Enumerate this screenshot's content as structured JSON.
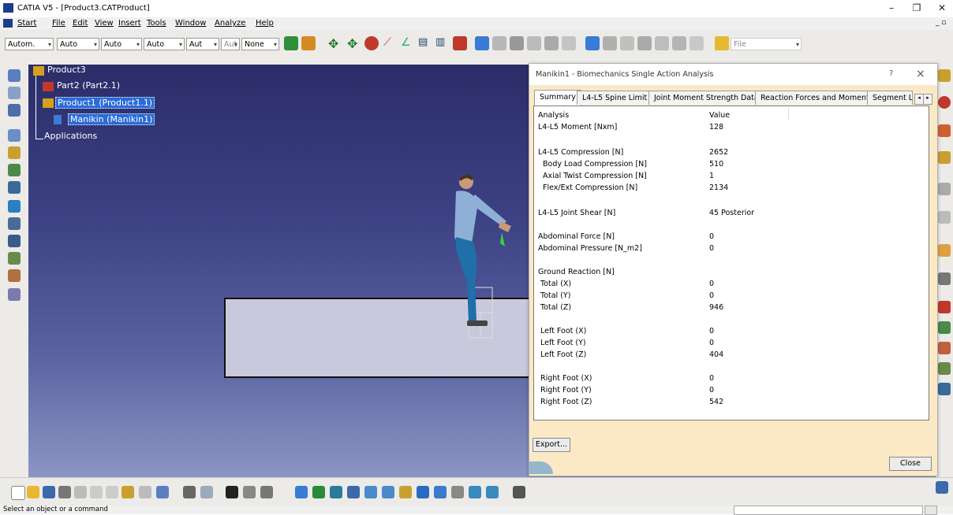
{
  "window": {
    "title": "CATIA V5 - [Product3.CATProduct]"
  },
  "menu": [
    "Start",
    "File",
    "Edit",
    "View",
    "Insert",
    "Tools",
    "Window",
    "Analyze",
    "Help"
  ],
  "toolbar": {
    "combos": [
      "Autom.",
      "Auto",
      "Auto",
      "Auto",
      "Aut",
      "Aut",
      "None"
    ],
    "file_combo": "File"
  },
  "tree": {
    "root": "Product3",
    "part2": "Part2 (Part2.1)",
    "product1": "Product1 (Product1.1)",
    "manikin": "Manikin (Manikin1)",
    "applications": "Applications"
  },
  "dialog": {
    "title": "Manikin1 - Biomechanics Single Action Analysis",
    "help": "?",
    "close_x": "×",
    "tabs": [
      "Summary",
      "L4-L5 Spine Limit",
      "Joint Moment Strength Data",
      "Reaction Forces and Moments",
      "Segment L"
    ],
    "header": {
      "analysis": "Analysis",
      "value": "Value"
    },
    "rows": [
      {
        "label": "L4-L5 Moment [Nxm]",
        "value": "128"
      },
      {
        "label": "L4-L5 Compression [N]",
        "value": "2652"
      },
      {
        "label": "Body Load Compression [N]",
        "value": "510"
      },
      {
        "label": "Axial Twist Compression [N]",
        "value": "1"
      },
      {
        "label": "Flex/Ext Compression [N]",
        "value": "2134"
      },
      {
        "label": "L4-L5 Joint Shear [N]",
        "value": "45  Posterior"
      },
      {
        "label": "Abdominal Force [N]",
        "value": "0"
      },
      {
        "label": "Abdominal Pressure [N_m2]",
        "value": "0"
      },
      {
        "label": "Ground Reaction [N]",
        "value": ""
      },
      {
        "label": "Total (X)",
        "value": "0"
      },
      {
        "label": "Total (Y)",
        "value": "0"
      },
      {
        "label": "Total (Z)",
        "value": "946"
      },
      {
        "label": "Left Foot (X)",
        "value": "0"
      },
      {
        "label": "Left Foot (Y)",
        "value": "0"
      },
      {
        "label": "Left Foot (Z)",
        "value": "404"
      },
      {
        "label": "Right Foot (X)",
        "value": "0"
      },
      {
        "label": "Right Foot (Y)",
        "value": "0"
      },
      {
        "label": "Right Foot (Z)",
        "value": "542"
      }
    ],
    "export": "Export...",
    "close": "Close"
  },
  "status": {
    "message": "Select an object or a command"
  },
  "colors": {
    "viewport_top": "#2b2d68",
    "viewport_bottom": "#8d95c4",
    "dialog_bg": "#fbe9c6",
    "selection": "#2b6bd6"
  }
}
